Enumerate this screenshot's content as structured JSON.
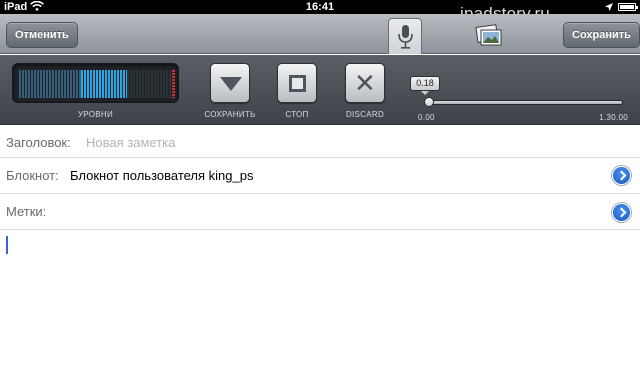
{
  "status_bar": {
    "carrier": "iPad",
    "time": "16:41",
    "icons": [
      "wifi-icon",
      "location-icon",
      "battery-icon"
    ]
  },
  "watermark": "ipadstory.ru",
  "nav": {
    "cancel_label": "Отменить",
    "save_label": "Сохранить",
    "tabs": [
      "microphone-icon",
      "photo-icon"
    ]
  },
  "recorder": {
    "levels_label": "УРОВНИ",
    "save_label": "СОХРАНИТЬ",
    "stop_label": "СТОП",
    "discard_label": "DISCARD",
    "position_value": "0.18",
    "range_start": "0.00",
    "range_end": "1.30.00",
    "colors": {
      "meter_active": "#2aa6e6",
      "meter_peak": "#c8303a"
    }
  },
  "form": {
    "title_label": "Заголовок:",
    "title_placeholder": "Новая заметка",
    "notebook_label": "Блокнот:",
    "notebook_value": "Блокнот пользователя king_ps",
    "tags_label": "Метки:"
  }
}
